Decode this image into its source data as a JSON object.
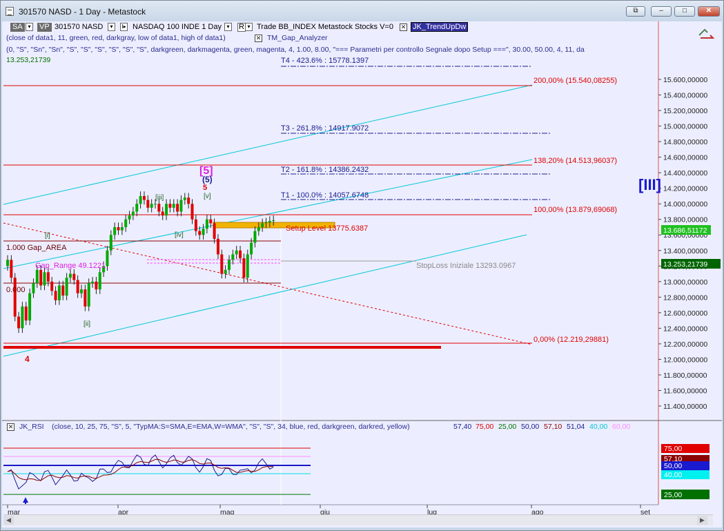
{
  "window": {
    "title": "301570 NASD - 1 Day - Metastock",
    "btn_restore": "⧉",
    "btn_minimize": "–",
    "btn_maximize": "□",
    "btn_close": "✕"
  },
  "toolbar": {
    "sa": "SA",
    "vp": "VP",
    "symbol": "301570 NASD",
    "instrument": "NASDAQ 100 INDE  1 Day",
    "r_label": "R",
    "trade": "Trade  BB_INDEX  Metastock  Stocks  V=0",
    "indicator": "JK_TrendUpDw"
  },
  "studies": {
    "line1": "(close of data1,  11,  green,  red,  darkgray,  low of data1,  high of data1)",
    "gap_analyzer": "TM_Gap_Analyzer",
    "line2": "(0,  \"S\",  \"Sn\",  \"Sn\",  \"S\",  \"S\",  \"S\",  \"S\",  \"S\",  \"S\",  darkgreen,  darkmagenta,  green,  magenta,  4,  1.00,  8.00,  \"=== Parametri per controllo Segnale dopo Setup ===\",  30.00,  50.00,  4,  11,  da",
    "line3": "13.253,21739"
  },
  "price_axis": {
    "ticks": [
      "15.600,00000",
      "15.400,00000",
      "15.200,00000",
      "15.000,00000",
      "14.800,00000",
      "14.600,00000",
      "14.400,00000",
      "14.200,00000",
      "14.000,00000",
      "13.800,00000",
      "13.600,00000",
      "13.400,00000",
      "13.200,00000",
      "13.000,00000",
      "12.800,00000",
      "12.600,00000",
      "12.400,00000",
      "12.200,00000",
      "12.000,00000",
      "11.800,00000",
      "11.600,00000",
      "11.400,00000"
    ],
    "last_price_tag": "13.686,51172",
    "stop_tag": "13.253,21739"
  },
  "fib_levels": {
    "f200": "200,00% (15.540,08255)",
    "f138": "138,20% (14.513,96037)",
    "f100": "100,00% (13.879,69068)",
    "f0": "0,00% (12.219,29881)"
  },
  "targets": {
    "t4": "T4 - 423.6% : 15778.1397",
    "t3": "T3 - 261.8% : 14917.9072",
    "t2": "T2 - 161.8% : 14386.2432",
    "t1": "T1 - 100.0% : 14057.6748",
    "setup": "Setup Level 13775.6387",
    "stoploss": "StopLoss Iniziale 13293.0967"
  },
  "gap": {
    "area": "1.000 Gap_AREA",
    "range": "Gap_Range 49.1221",
    "zero": "0.000"
  },
  "waves": {
    "w4": "4",
    "wi": "[i]",
    "wii": "[ii]",
    "wiii": "[iii]",
    "wiv": "[iv]",
    "wv": "[v]",
    "w5paren": "(5)",
    "w5": "5",
    "w5bracket": "[5]",
    "wIII": "[III]"
  },
  "date_axis": [
    "mar",
    "apr",
    "mag",
    "giu",
    "lug",
    "ago",
    "set"
  ],
  "rsi": {
    "label": "JK_RSI",
    "params": "(close,  10,  25,  75,  \"S\",  5,  \"TypMA:S=SMA,E=EMA,W=WMA\",  \"S\",  \"S\",  34,  blue,  red,  darkgreen,  darkred,  yellow)",
    "v1": "57,40",
    "v2": "75,00",
    "v3": "25,00",
    "v4": "50,00",
    "v5": "57,10",
    "v6": "51,04",
    "v7": "40,00",
    "v8": "60,00",
    "axis_tags": [
      "75,00",
      "57,10",
      "50,00",
      "40,00",
      "25,00"
    ]
  },
  "colors": {
    "background": "#eceeff",
    "up_candle": "#00aa00",
    "down_candle": "#e00000",
    "fib_line": "#e00000",
    "channel": "#00c8d8",
    "target_line": "#1a1a8a"
  },
  "chart_data": {
    "type": "candlestick",
    "ylim": [
      11300,
      15800
    ],
    "x": [
      "mar",
      "apr",
      "mag",
      "giu",
      "lug",
      "ago",
      "set"
    ],
    "candles_close": [
      13280,
      13050,
      12550,
      12400,
      12680,
      12500,
      12850,
      12980,
      13150,
      12950,
      13120,
      13000,
      12880,
      12760,
      12950,
      12820,
      13050,
      13100,
      13020,
      12850,
      12900,
      12680,
      12980,
      13000,
      12900,
      13120,
      13200,
      13400,
      13600,
      13700,
      13660,
      13700,
      13800,
      13850,
      13900,
      14000,
      14100,
      14050,
      13950,
      14000,
      14000,
      13900,
      13850,
      14000,
      13950,
      14000,
      13900,
      14050,
      14080,
      14000,
      13800,
      13650,
      13600,
      13680,
      13800,
      13750,
      13550,
      13350,
      13100,
      13150,
      13280,
      13350,
      13400,
      13300,
      13050,
      13350,
      13500,
      13650,
      13700,
      13750,
      13760,
      13780,
      13790
    ],
    "fib_pct": [
      "200,00%",
      "138,20%",
      "100,00%",
      "0,00%"
    ],
    "rsi_levels": [
      75,
      60,
      50,
      40,
      25
    ]
  }
}
